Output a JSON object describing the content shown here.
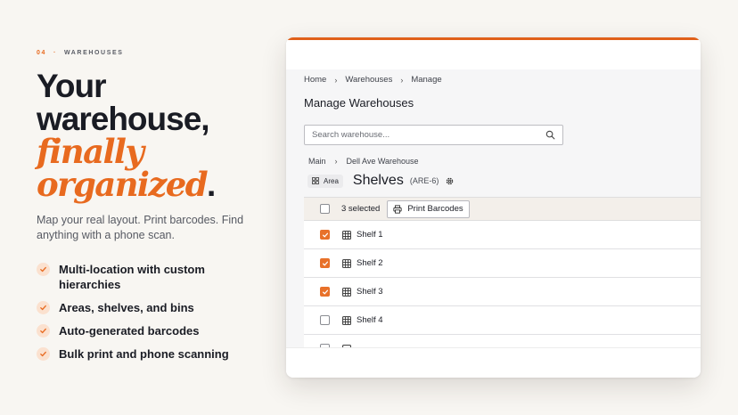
{
  "eyebrow": {
    "number": "04",
    "label": "WAREHOUSES"
  },
  "headline": {
    "line1": "Your",
    "line2": "warehouse,",
    "accent1": "finally",
    "accent2": "organized",
    "period": "."
  },
  "lead": "Map your real layout. Print barcodes. Find anything with a phone scan.",
  "features": [
    {
      "text": "Multi-location with custom hierarchies",
      "icon": "check-icon"
    },
    {
      "text": "Areas, shelves, and bins",
      "icon": "check-icon"
    },
    {
      "text": "Auto-generated barcodes",
      "icon": "check-icon"
    },
    {
      "text": "Bulk print and phone scanning",
      "icon": "check-icon"
    }
  ],
  "app": {
    "breadcrumb": [
      "Home",
      "Warehouses",
      "Manage"
    ],
    "page_title": "Manage Warehouses",
    "search_placeholder": "Search warehouse...",
    "sub_breadcrumb": [
      "Main",
      "Dell Ave Warehouse"
    ],
    "area_chip": "Area",
    "heading": "Shelves",
    "heading_code": "(ARE-6)",
    "selected_label": "3 selected",
    "print_label": "Print Barcodes",
    "rows": [
      {
        "name": "Shelf 1",
        "checked": true
      },
      {
        "name": "Shelf 2",
        "checked": true
      },
      {
        "name": "Shelf 3",
        "checked": true
      },
      {
        "name": "Shelf 4",
        "checked": false
      }
    ]
  },
  "colors": {
    "accent": "#e86a1f",
    "background": "#f8f6f2",
    "check_bg": "#fbe1cf"
  }
}
